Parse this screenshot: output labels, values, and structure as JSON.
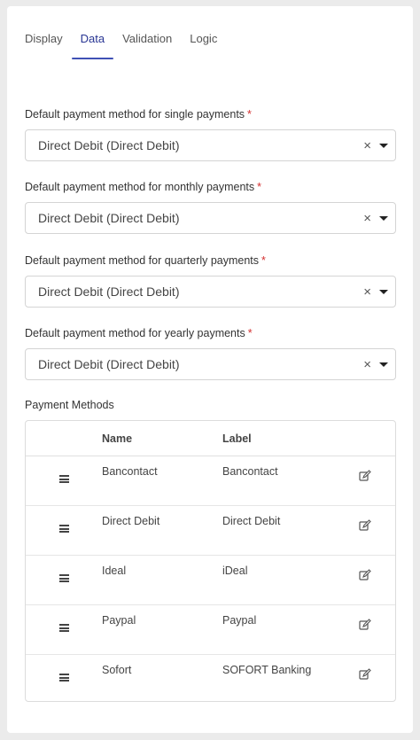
{
  "tabs": [
    {
      "label": "Display"
    },
    {
      "label": "Data"
    },
    {
      "label": "Validation"
    },
    {
      "label": "Logic"
    }
  ],
  "fields": [
    {
      "label": "Default payment method for single payments",
      "required": "*",
      "value": "Direct Debit (Direct Debit)"
    },
    {
      "label": "Default payment method for monthly payments",
      "required": "*",
      "value": "Direct Debit (Direct Debit)"
    },
    {
      "label": "Default payment method for quarterly payments",
      "required": "*",
      "value": "Direct Debit (Direct Debit)"
    },
    {
      "label": "Default payment method for yearly payments",
      "required": "*",
      "value": "Direct Debit (Direct Debit)"
    }
  ],
  "icons": {
    "clear": "×",
    "caret": "caret-down-icon",
    "drag": "drag-handle-icon",
    "edit": "edit-icon"
  },
  "payment_methods": {
    "title": "Payment Methods",
    "columns": {
      "name": "Name",
      "label": "Label"
    },
    "rows": [
      {
        "name": "Bancontact",
        "label": "Bancontact"
      },
      {
        "name": "Direct Debit",
        "label": "Direct Debit"
      },
      {
        "name": "Ideal",
        "label": "iDeal"
      },
      {
        "name": "Paypal",
        "label": "Paypal"
      },
      {
        "name": "Sofort",
        "label": "SOFORT Banking"
      }
    ]
  },
  "colors": {
    "accent": "#3f51b5",
    "active_tab_text": "#283593",
    "required": "#d32f2f"
  }
}
